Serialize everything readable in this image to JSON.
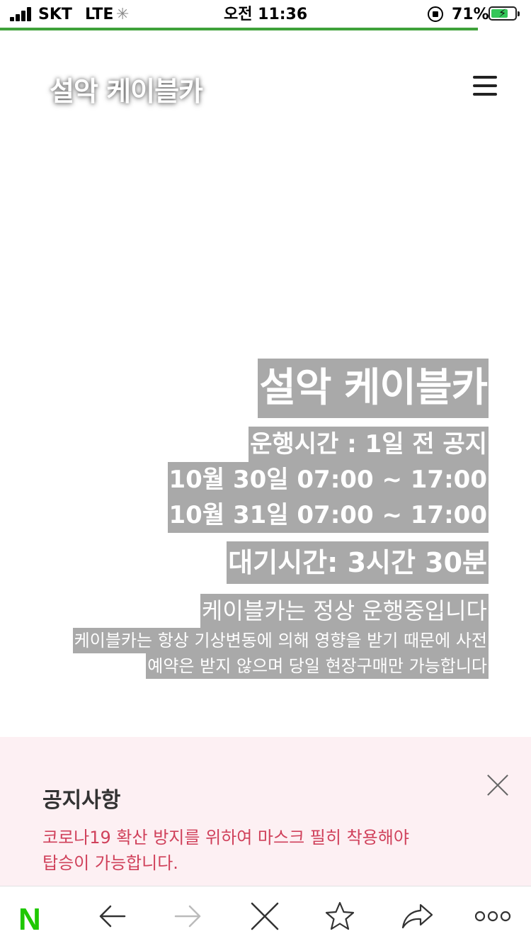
{
  "status_bar": {
    "carrier": "SKT",
    "network": "LTE",
    "time": "오전 11:36",
    "battery": "71%",
    "battery_level": 0.71,
    "page_load_progress": 0.9
  },
  "header": {
    "logo": "설악 케이블카",
    "menu_icon": "hamburger-menu-icon"
  },
  "hero": {
    "title": "설악 케이블카",
    "schedule_heading": "운행시간 : 1일 전 공지",
    "schedule": [
      "10월 30일 07:00 ~ 17:00",
      "10월 31일 07:00 ~ 17:00"
    ],
    "wait_time": "대기시간: 3시간 30분",
    "operation_status": "케이블카는 정상 운행중입니다",
    "notes": [
      "케이블카는 항상 기상변동에 의해 영향을 받기 때문에 사전",
      "예약은 받지 않으며 당일 현장구매만 가능합니다"
    ]
  },
  "notice": {
    "title": "공지사항",
    "body_lines": [
      "코로나19 확산 방지를 위하여 마스크 필히 착용해야",
      "탑승이 가능합니다."
    ],
    "close_icon": "close-icon"
  },
  "toolbar": {
    "home_logo": "N",
    "items": [
      "back-arrow-icon",
      "forward-arrow-icon",
      "close-icon",
      "star-icon",
      "share-icon",
      "more-icon"
    ]
  },
  "colors": {
    "progress": "#3fa23a",
    "highlight_bg": "#a9a9a9",
    "notice_bg": "#fdf0f3",
    "notice_text": "#d0415b",
    "naver_green": "#1fc800"
  }
}
